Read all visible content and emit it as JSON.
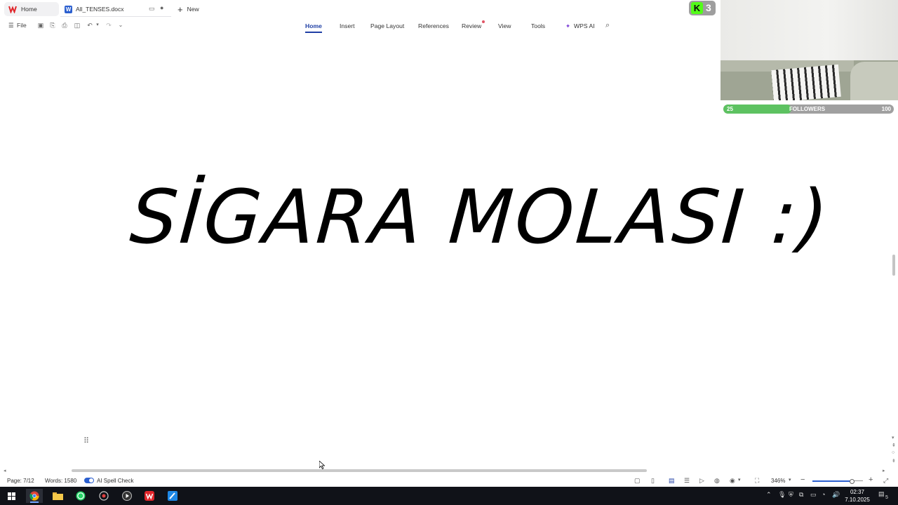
{
  "tabs": {
    "home": "Home",
    "document": "All_TENSES.docx",
    "new": "New"
  },
  "toolbar": {
    "file": "File",
    "ribbon": [
      "Home",
      "Insert",
      "Page Layout",
      "References",
      "Review",
      "View",
      "Tools",
      "WPS AI"
    ],
    "active_tab": "Home"
  },
  "document": {
    "text": "SİGARA MOLASI :)"
  },
  "status": {
    "page": "Page: 7/12",
    "words": "Words: 1580",
    "spell_check": "AI Spell Check",
    "zoom": "346%",
    "zoom_fraction": 0.78
  },
  "overlay": {
    "kick_count": "3",
    "followers_label": "FOLLOWERS",
    "followers_current": "25",
    "followers_goal": "100",
    "followers_fraction": 0.25
  },
  "taskbar": {
    "time": "02:37",
    "date": "7.10.2025",
    "notifications": "5"
  },
  "colors": {
    "accent": "#1f3fa5",
    "kick_green": "#53fc18",
    "followers_fill": "#5dc261",
    "wps_red": "#e0262b"
  }
}
